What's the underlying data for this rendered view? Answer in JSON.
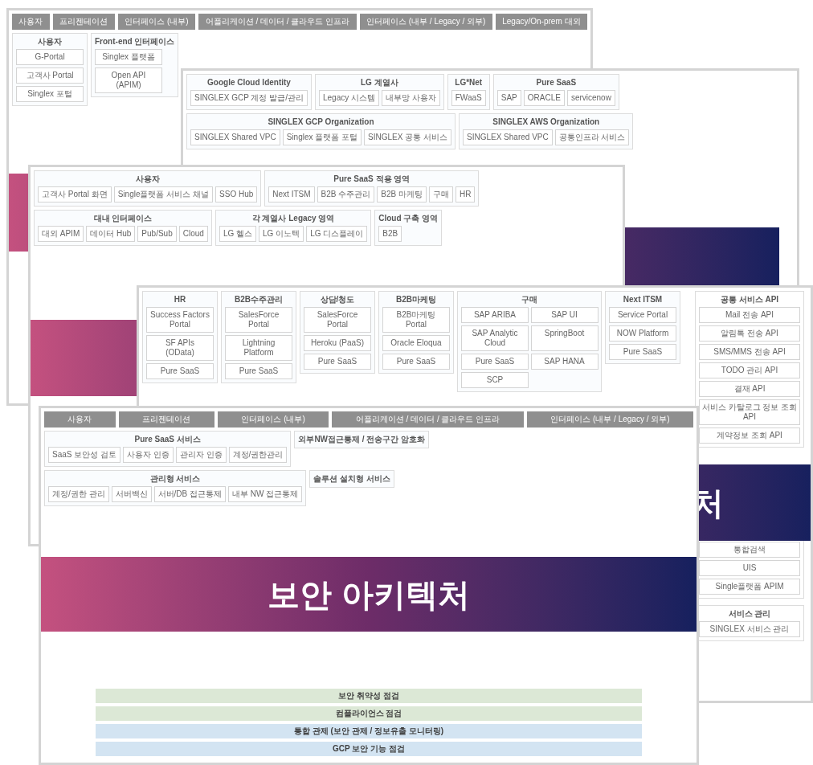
{
  "cards": [
    {
      "header": [
        "사용자",
        "프리젠테이션",
        "인터페이스 (내부)",
        "어플리케이션 / 데이터 / 클라우드 인프라",
        "인터페이스 (내부 / Legacy / 외부)",
        "Legacy/On-prem 대외"
      ],
      "groups": [
        {
          "title": "사용자",
          "items": [
            "G-Portal",
            "고객사 Portal",
            "Singlex 포털"
          ]
        },
        {
          "title": "Front-end 인터페이스",
          "items": [
            "Singlex 플랫폼",
            "Open API (APIM)"
          ]
        }
      ]
    },
    {
      "groups": [
        {
          "title": "Google Cloud Identity",
          "items": [
            "SINGLEX GCP 계정 발급/관리"
          ]
        },
        {
          "title": "LG 계열사",
          "items": [
            "Legacy 시스템",
            "내부망 사용자"
          ]
        },
        {
          "title": "LG*Net",
          "items": [
            "FWaaS"
          ]
        },
        {
          "title": "Pure SaaS",
          "items": [
            "SAP",
            "ORACLE",
            "servicenow"
          ]
        },
        {
          "title": "SINGLEX GCP Organization",
          "items": [
            "SINGLEX Shared VPC",
            "Singlex 플랫폼 포털",
            "SINGLEX 공통 서비스"
          ]
        },
        {
          "title": "SINGLEX AWS Organization",
          "items": [
            "SINGLEX Shared VPC",
            "공통인프라 서비스"
          ]
        }
      ]
    },
    {
      "groups": [
        {
          "title": "사용자",
          "items": [
            "고객사 Portal 화면",
            "Single플랫폼 서비스 채널",
            "SSO Hub"
          ]
        },
        {
          "title": "Pure SaaS 적용 영역",
          "items": [
            "Next ITSM",
            "B2B 수주관리",
            "B2B 마케팅",
            "구매",
            "HR"
          ]
        },
        {
          "title": "대내 인터페이스",
          "items": [
            "대외 APIM",
            "데이터 Hub",
            "Pub/Sub",
            "Cloud"
          ]
        },
        {
          "title": "각 계열사 Legacy 영역",
          "items": [
            "LG 헬스",
            "LG 이노텍",
            "LG 디스플레이"
          ]
        },
        {
          "title": "Cloud 구축 영역",
          "items": [
            "B2B"
          ]
        }
      ]
    },
    {
      "groups": [
        {
          "title": "HR",
          "items": [
            "Success Factors Portal",
            "SF APIs (OData)",
            "Pure SaaS"
          ]
        },
        {
          "title": "B2B수주관리",
          "items": [
            "SalesForce Portal",
            "Lightning Platform",
            "Pure SaaS"
          ]
        },
        {
          "title": "상담/청도",
          "items": [
            "SalesForce Portal",
            "Heroku (PaaS)",
            "Pure SaaS"
          ]
        },
        {
          "title": "B2B마케팅",
          "items": [
            "B2B마케팅 Portal",
            "Oracle Eloqua",
            "Pure SaaS"
          ]
        },
        {
          "title": "구매",
          "items": [
            "SAP ARIBA",
            "SAP UI",
            "SAP Analytic Cloud",
            "SpringBoot",
            "Pure SaaS",
            "SAP HANA",
            "SCP"
          ]
        },
        {
          "title": "Next ITSM",
          "items": [
            "Service Portal",
            "NOW Platform",
            "Pure SaaS"
          ]
        }
      ],
      "panel": [
        {
          "title": "공통 서비스 API",
          "items": [
            "Mail 전송 API",
            "알림톡 전송 API",
            "SMS/MMS 전송 API",
            "TODO 관리 API",
            "결재 API",
            "서비스 카탈로그 정보 조회 API",
            "계약정보 조회 API"
          ]
        },
        {
          "items": [
            "통합검색",
            "UIS",
            "Single플랫폼 APIM"
          ]
        },
        {
          "title": "서비스 관리",
          "items": [
            "SINGLEX 서비스 관리"
          ]
        }
      ],
      "banner_text": "처"
    },
    {
      "header": [
        "사용자",
        "프리젠테이션",
        "인터페이스 (내부)",
        "어플리케이션 / 데이터 / 클라우드 인프라",
        "인터페이스 (내부 / Legacy / 외부)"
      ],
      "groups": [
        {
          "title": "Pure SaaS 서비스",
          "items": [
            "SaaS 보안성 검토",
            "사용자 인증",
            "관리자 인증",
            "계정/권한관리"
          ]
        },
        {
          "title": "외부NW접근통제 / 전송구간 암호화"
        },
        {
          "title": "관리형 서비스",
          "items": [
            "계정/권한 관리",
            "서버백신",
            "서버/DB 접근통제",
            "내부 NW 접근통제"
          ]
        },
        {
          "title": "솔루션 설치형 서비스"
        }
      ],
      "strips": [
        {
          "text": "보안 취약성 점검",
          "color": "#dce8d6"
        },
        {
          "text": "컴플라이언스 점검",
          "color": "#dce8d6"
        },
        {
          "text": "통합 관제 (보안 관제 / 정보유출 모니터링)",
          "color": "#d3e4f2"
        },
        {
          "text": "GCP 보안 기능 점검",
          "color": "#d3e4f2"
        }
      ],
      "banner_text": "보안 아키텍처"
    }
  ]
}
